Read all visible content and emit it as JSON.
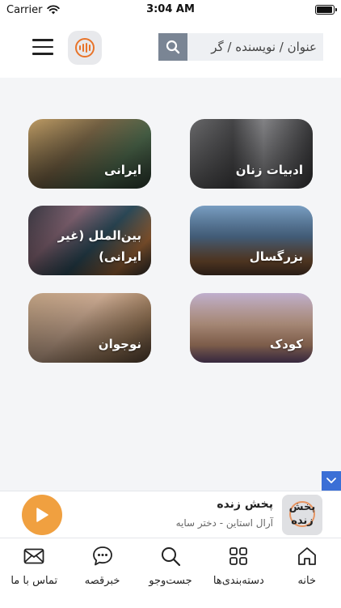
{
  "status_bar": {
    "carrier": "Carrier",
    "time": "3:04 AM"
  },
  "header": {
    "search": {
      "placeholder": "عنوان / نویسنده / گر"
    }
  },
  "categories": [
    {
      "id": "women",
      "label": "ادبیات زنان"
    },
    {
      "id": "iranian",
      "label": "ایرانی"
    },
    {
      "id": "adult",
      "label": "بزرگسال"
    },
    {
      "id": "international",
      "label": "بین‌الملل (غیر ایرانی)"
    },
    {
      "id": "kids",
      "label": "کودک"
    },
    {
      "id": "teen",
      "label": "نوجوان"
    }
  ],
  "player": {
    "title": "پخش زنده",
    "subtitle": "آرال استاین - دختر سایه",
    "cover_text": "پخش زنده",
    "accent": "#f0a040"
  },
  "tabbar": {
    "items": [
      {
        "label": "خانه",
        "icon": "home-icon"
      },
      {
        "label": "دسته‌بندی‌ها",
        "icon": "grid-icon"
      },
      {
        "label": "جست‌وجو",
        "icon": "search-icon"
      },
      {
        "label": "خبرقصه",
        "icon": "chat-icon"
      },
      {
        "label": "تماس با ما",
        "icon": "mail-icon"
      }
    ]
  },
  "colors": {
    "accent_orange": "#e8742a",
    "search_button": "#7a8594",
    "scroll_button": "#3b6fd6"
  }
}
